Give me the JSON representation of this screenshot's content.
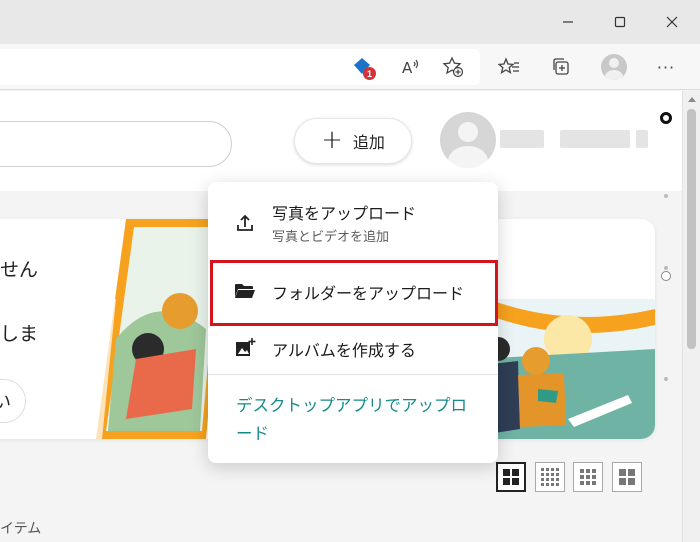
{
  "browser": {
    "toolbar_icons": [
      {
        "name": "extension-shield-icon",
        "badge": "1"
      },
      {
        "name": "read-aloud-icon",
        "label": "A"
      },
      {
        "name": "add-favorite-icon"
      },
      {
        "name": "favorites-icon"
      },
      {
        "name": "collections-icon"
      },
      {
        "name": "profile-icon"
      },
      {
        "name": "more-icon",
        "label": "···"
      }
    ]
  },
  "header": {
    "add_button_label": "追加"
  },
  "card": {
    "line1": "せん",
    "line2": "しま",
    "pill_label": "い"
  },
  "menu": {
    "items": [
      {
        "label": "写真をアップロード",
        "sublabel": "写真とビデオを追加",
        "icon": "upload-icon"
      },
      {
        "label": "フォルダーをアップロード",
        "icon": "folder-icon",
        "highlighted": true
      },
      {
        "label": "アルバムを作成する",
        "icon": "album-icon"
      }
    ],
    "link_label": "デスクトップアプリでアップロード"
  },
  "view_modes": [
    {
      "name": "view-large-grid",
      "active": true
    },
    {
      "name": "view-small-grid",
      "active": false
    },
    {
      "name": "view-medium-grid",
      "active": false
    },
    {
      "name": "view-tiles",
      "active": false
    }
  ],
  "footer": {
    "items_label": "イテム"
  },
  "colors": {
    "accent_link": "#168a8a",
    "highlight_border": "#d4141c",
    "badge": "#d13438"
  }
}
